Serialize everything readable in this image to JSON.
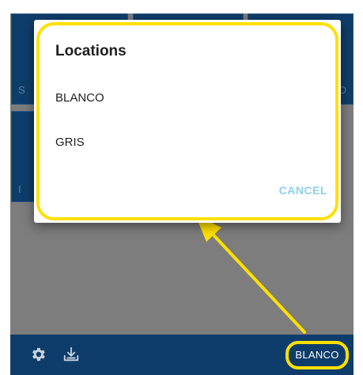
{
  "dialog": {
    "title": "Locations",
    "options": [
      "BLANCO",
      "GRIS"
    ],
    "cancel_label": "CANCEL"
  },
  "bottom_bar": {
    "current_location": "BLANCO",
    "icons": [
      "gear-icon",
      "download-tray-icon"
    ]
  },
  "colors": {
    "app_blue": "#0f3d6b",
    "highlight_yellow": "#ffe000",
    "cancel_blue": "#8fd0f0",
    "overlay_gray": "#7d7d7d"
  }
}
